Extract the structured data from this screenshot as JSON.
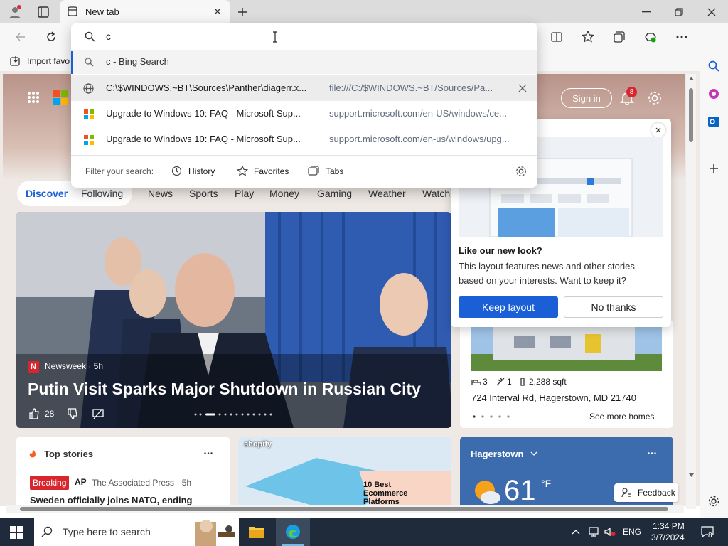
{
  "browser": {
    "tab_title": "New tab",
    "address_value": "c",
    "favorites_bar_item": "Import favo",
    "notification_count": "8"
  },
  "dropdown": {
    "search_suggestion": "c - Bing Search",
    "items": [
      {
        "title": "C:\\$WINDOWS.~BT\\Sources\\Panther\\diagerr.x...",
        "url": "file:///C:/$WINDOWS.~BT/Sources/Pa..."
      },
      {
        "title": "Upgrade to Windows 10: FAQ - Microsoft Sup...",
        "url": "support.microsoft.com/en-US/windows/ce..."
      },
      {
        "title": "Upgrade to Windows 10: FAQ - Microsoft Sup...",
        "url": "support.microsoft.com/en-us/windows/upg..."
      }
    ],
    "filter_label": "Filter your search:",
    "filters": [
      "History",
      "Favorites",
      "Tabs"
    ]
  },
  "page": {
    "sign_in": "Sign in",
    "nav": [
      "Discover",
      "Following",
      "News",
      "Sports",
      "Play",
      "Money",
      "Gaming",
      "Weather",
      "Watch"
    ],
    "hero": {
      "source": "Newsweek · 5h",
      "headline": "Putin Visit Sparks Major Shutdown in Russian City",
      "likes": "28"
    },
    "popup": {
      "title": "Like our new look?",
      "body": "This layout features news and other stories based on your interests. Want to keep it?",
      "keep": "Keep layout",
      "no": "No thanks"
    },
    "home": {
      "beds": "3",
      "baths": "1",
      "sqft": "2,288 sqft",
      "address": "724 Interval Rd, Hagerstown, MD 21740",
      "see_more": "See more homes"
    },
    "top_stories": {
      "title": "Top stories",
      "badge": "Breaking",
      "source": "The Associated Press · 5h",
      "headline": "Sweden officially joins NATO, ending"
    },
    "ad": {
      "brand": "shopify",
      "text": "10 Best Ecommerce Platforms"
    },
    "weather": {
      "city": "Hagerstown",
      "temp": "61",
      "unit": "°F"
    },
    "feedback": "Feedback"
  },
  "taskbar": {
    "search_placeholder": "Type here to search",
    "lang": "ENG",
    "time": "1:34 PM",
    "date": "3/7/2024",
    "notif": "8"
  },
  "colors": {
    "accent": "#1a5fd6",
    "breaking": "#d9262c",
    "taskbar": "#1f2b3a"
  }
}
